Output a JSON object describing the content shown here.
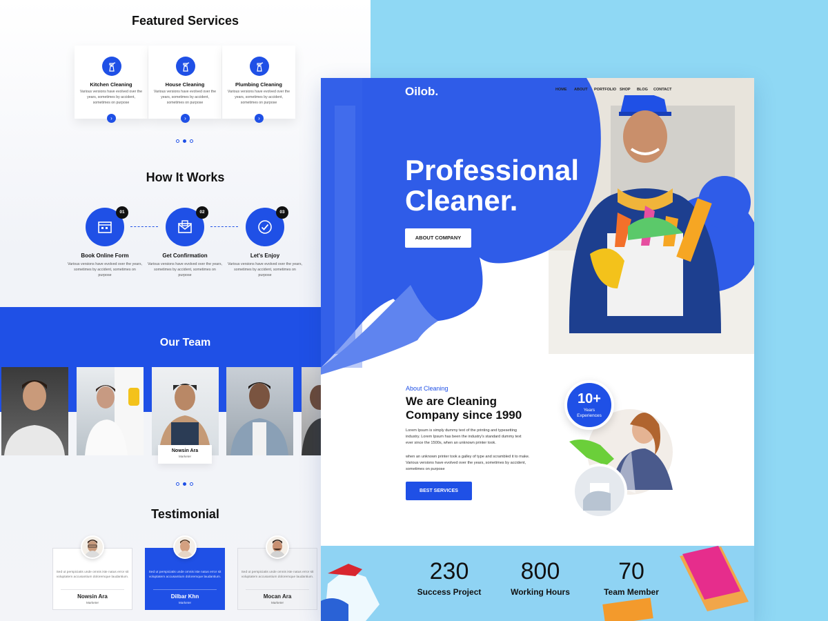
{
  "featured": {
    "title": "Featured Services",
    "cards": [
      {
        "name": "Kitchen Cleaning",
        "text": "Various versions have evolved over the years, sometimes by accident, sometimes on purpose",
        "icon": "spray-bottle-icon"
      },
      {
        "name": "House Cleaning",
        "text": "Various versions have evolved over the years, sometimes by accident, sometimes on purpose",
        "icon": "spray-bottle-icon"
      },
      {
        "name": "Plumbing Cleaning",
        "text": "Various versions have evolved over the years, sometimes by accident, sometimes on purpose",
        "icon": "spray-bottle-icon"
      }
    ]
  },
  "how": {
    "title": "How It Works",
    "steps": [
      {
        "num": "01",
        "name": "Book Online Form",
        "text": "Various versions have evolved over the years, sometimes by accident, sometimes on purpose",
        "icon": "calendar-icon"
      },
      {
        "num": "02",
        "name": "Get Confirmation",
        "text": "Various versions have evolved over the years, sometimes by accident, sometimes on purpose",
        "icon": "envelope-icon"
      },
      {
        "num": "03",
        "name": "Let's Enjoy",
        "text": "Various versions have evolved over the years, sometimes by accident, sometimes on purpose",
        "icon": "check-icon"
      }
    ]
  },
  "team": {
    "title": "Our Team",
    "featured_member": {
      "name": "Nowsin Ara",
      "role": "Marketer"
    }
  },
  "testimonial": {
    "title": "Testimonial",
    "items": [
      {
        "text": "Sed ut perspiciatis unde omnis iste natus error sit voluptatem accusantium doloremque laudantium.",
        "name": "Nowsin Ara",
        "role": "Marketer"
      },
      {
        "text": "Sed ut perspiciatis unde omnis iste natus error sit voluptatem accusantium doloremque laudantium.",
        "name": "Dilbar Khn",
        "role": "Marketer"
      },
      {
        "text": "Sed ut perspiciatis unde omnis iste natus error sit voluptatem accusantium doloremque laudantium.",
        "name": "Mocan Ara",
        "role": "Marketer"
      }
    ]
  },
  "site": {
    "logo": "Oilob.",
    "nav": [
      "HOME",
      "ABOUT",
      "PORTFOLIO",
      "SHOP",
      "BLOG",
      "CONTACT"
    ]
  },
  "hero": {
    "title_line1": "Professional",
    "title_line2": "Cleaner.",
    "button": "ABOUT COMPANY"
  },
  "about": {
    "kicker": "About Cleaning",
    "title": "We are Cleaning Company since 1990",
    "p1": "Lorem Ipsum is simply dummy text of the printing and typesetting industry. Lorem Ipsum has been the industry's standard dummy text ever since the 1500s, when an unknown printer took.",
    "p2": "when an unknown printer took a galley of type and scrambled it to make. Various versions have evolved over the years, sometimes by accident, sometimes on purpose",
    "button": "BEST SERVICES",
    "badge_num": "10+",
    "badge_text": "Years Experiences"
  },
  "stats": [
    {
      "num": "230",
      "label": "Success Project"
    },
    {
      "num": "800",
      "label": "Working  Hours"
    },
    {
      "num": "70",
      "label": "Team Member"
    }
  ],
  "colors": {
    "brand": "#1f50e6",
    "sky": "#8fd8f4"
  }
}
